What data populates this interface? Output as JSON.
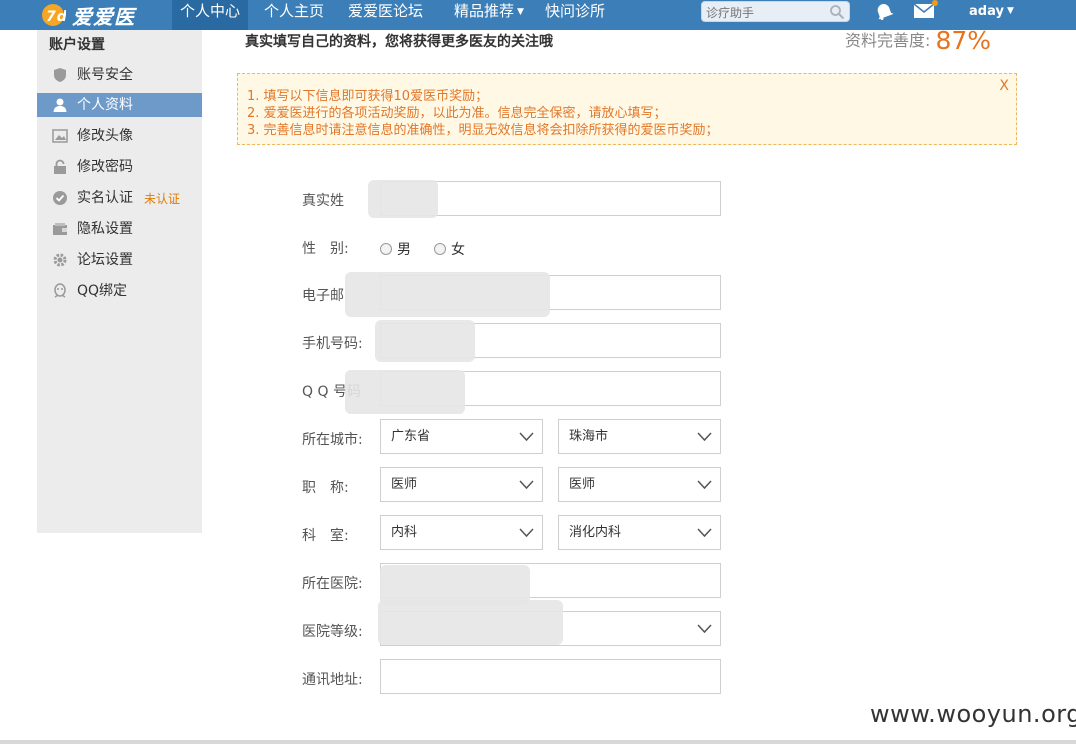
{
  "nav": {
    "logo_text": "爱爱医",
    "items": [
      {
        "label": "个人中心",
        "active": true
      },
      {
        "label": "个人主页",
        "active": false
      },
      {
        "label": "爱爱医论坛",
        "active": false
      },
      {
        "label": "精品推荐",
        "active": false,
        "dropdown": true
      },
      {
        "label": "快问诊所",
        "active": false
      }
    ],
    "search_placeholder": "诊疗助手",
    "username": "aday",
    "icons": [
      "bell-icon",
      "mail-icon",
      "search-icon"
    ],
    "bar_color": "#3c7fb8"
  },
  "sidebar": {
    "title": "账户设置",
    "items": [
      {
        "label": "账号安全",
        "icon": "shield-icon",
        "active": false
      },
      {
        "label": "个人资料",
        "icon": "user-icon",
        "active": true
      },
      {
        "label": "修改头像",
        "icon": "image-icon",
        "active": false
      },
      {
        "label": "修改密码",
        "icon": "lock-icon",
        "active": false
      },
      {
        "label": "实名认证",
        "icon": "check-circle-icon",
        "active": false,
        "badge": "未认证"
      },
      {
        "label": "隐私设置",
        "icon": "wallet-icon",
        "active": false
      },
      {
        "label": "论坛设置",
        "icon": "gear-icon",
        "active": false
      },
      {
        "label": "QQ绑定",
        "icon": "qq-icon",
        "active": false
      }
    ]
  },
  "header": {
    "intro": "真实填写自己的资料，您将获得更多医友的关注哦",
    "completeness_label": "资料完善度:",
    "completeness_value": "87%"
  },
  "notice": {
    "lines": [
      "1. 填写以下信息即可获得10爱医币奖励；",
      "2. 爱爱医进行的各项活动奖励，以此为准。信息完全保密，请放心填写；",
      "3. 完善信息时请注意信息的准确性，明显无效信息将会扣除所获得的爱医币奖励；"
    ],
    "close_label": "X",
    "accent": "#e2772a"
  },
  "form": {
    "real_name_label": "真实姓",
    "gender_label": "性　别:",
    "gender_options": [
      "男",
      "女"
    ],
    "email_label": "电子邮",
    "phone_label": "手机号码:",
    "qq_label": "Q Q 号码",
    "city_label": "所在城市:",
    "province_value": "广东省",
    "city_value": "珠海市",
    "title_label": "职　称:",
    "title_value_1": "医师",
    "title_value_2": "医师",
    "dept_label": "科　室:",
    "dept_value_1": "内科",
    "dept_value_2": "消化内科",
    "hospital_label": "所在医院:",
    "hospital_level_label": "医院等级:",
    "address_label": "通讯地址:"
  },
  "watermark": "www.wooyun.org"
}
